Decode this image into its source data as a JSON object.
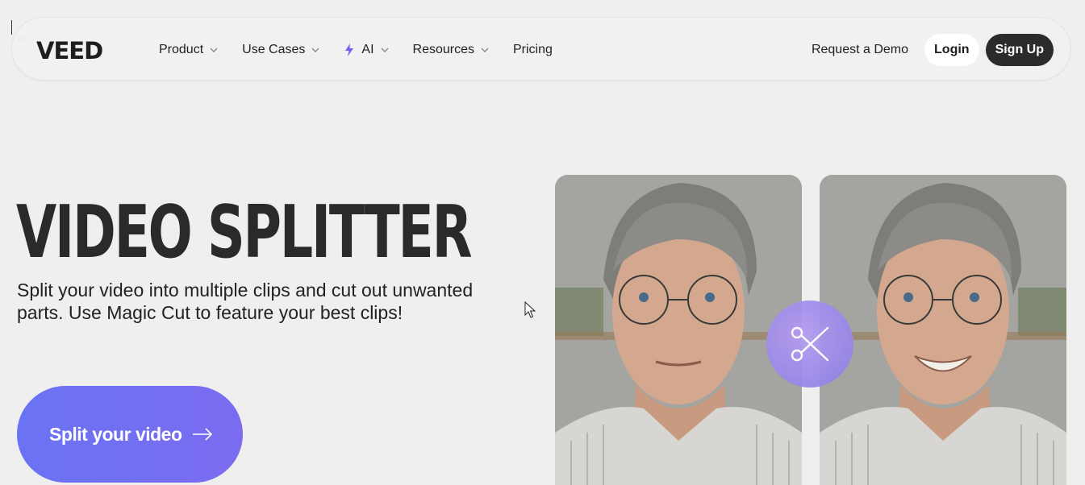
{
  "breadcrumb": {
    "text": "Ho"
  },
  "nav": {
    "logo": "VEED",
    "menu": [
      {
        "label": "Product",
        "has_dropdown": true
      },
      {
        "label": "Use Cases",
        "has_dropdown": true
      },
      {
        "label": "AI",
        "has_dropdown": true,
        "icon": "bolt-icon"
      },
      {
        "label": "Resources",
        "has_dropdown": true
      },
      {
        "label": "Pricing",
        "has_dropdown": false
      }
    ],
    "request_demo": "Request a Demo",
    "login": "Login",
    "signup": "Sign Up"
  },
  "hero": {
    "title": "VIDEO SPLITTER",
    "subtitle": "Split your video into multiple clips and cut out unwanted parts. Use Magic Cut to feature your best clips!",
    "cta_label": "Split your video"
  },
  "colors": {
    "background": "#eeefee",
    "cta_gradient_start": "#6a73f4",
    "cta_gradient_end": "#7b6cf0",
    "ai_bolt": "#7a5cf0",
    "signup_bg": "#2b2b2b",
    "scissors_badge": "#9c8ae9"
  },
  "icons": {
    "cta_arrow": "arrow-right-icon",
    "badge": "scissors-icon",
    "dropdown": "chevron-down-icon"
  }
}
